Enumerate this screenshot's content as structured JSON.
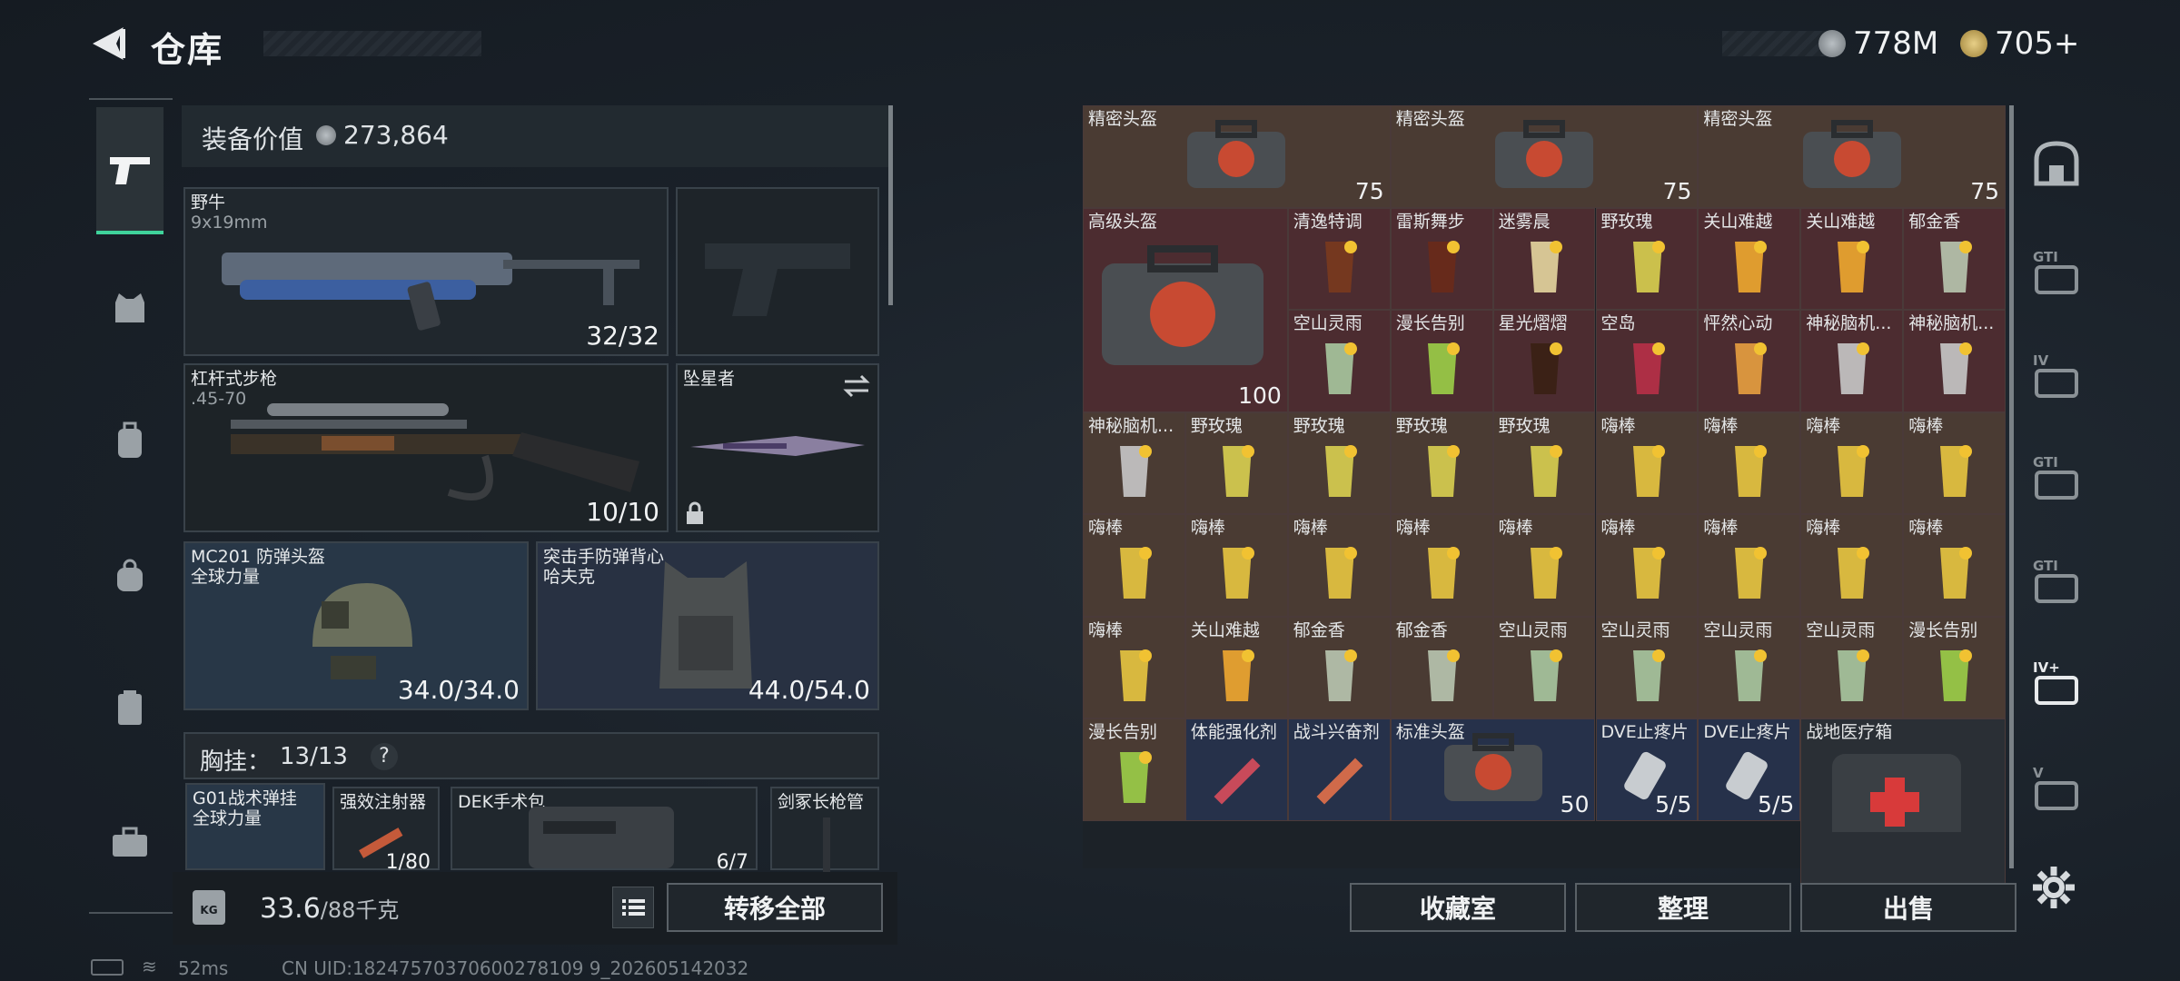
{
  "header": {
    "title": "仓库",
    "currency1": "778M",
    "currency2": "705+"
  },
  "left": {
    "value_label": "装备价值",
    "value": "273,864",
    "weapon1": {
      "name": "野牛",
      "ammo": "9x19mm",
      "count": "32/32"
    },
    "weapon2": {
      "name": "杠杆式步枪",
      "ammo": ".45-70",
      "count": "10/10"
    },
    "melee": {
      "name": "坠星者"
    },
    "helmet": {
      "name": "MC201 防弹头盔",
      "brand": "全球力量",
      "dur": "34.0/34.0"
    },
    "vest": {
      "name": "突击手防弹背心",
      "brand": "哈夫克",
      "dur": "44.0/54.0"
    },
    "chest_label": "胸挂：",
    "chest_count": "13/13",
    "chest_help": "?",
    "slot1": {
      "name": "G01战术弹挂",
      "brand": "全球力量"
    },
    "slot2": {
      "name": "强效注射器",
      "count": "1/80"
    },
    "slot3": {
      "name": "DEK手术包",
      "count": "6/7"
    },
    "slot4": {
      "name": "剑冢长枪管"
    },
    "weight": "33.6",
    "weight_max": "/88千克",
    "transfer_all": "转移全部",
    "kg": "KG"
  },
  "status": {
    "ping": "52ms",
    "uid": "CN UID:18247570370600278109 9_202605142032"
  },
  "grid": {
    "row0": [
      {
        "label": "精密头盔",
        "count": "75"
      },
      {
        "label": "精密头盔",
        "count": "75"
      },
      {
        "label": "精密头盔",
        "count": "75"
      }
    ],
    "big": {
      "label": "高级头盔",
      "count": "100"
    },
    "row1a": [
      "清逸特调",
      "雷斯舞步",
      "迷雾晨",
      "野玫瑰",
      "关山难越",
      "关山难越",
      "郁金香"
    ],
    "row1b": [
      "空山灵雨",
      "漫长告别",
      "星光熠熠",
      "空岛",
      "怦然心动",
      "神秘脑机...",
      "神秘脑机..."
    ],
    "row2": [
      "神秘脑机...",
      "野玫瑰",
      "野玫瑰",
      "野玫瑰",
      "野玫瑰",
      "嗨棒",
      "嗨棒",
      "嗨棒",
      "嗨棒"
    ],
    "row3": [
      "嗨棒",
      "嗨棒",
      "嗨棒",
      "嗨棒",
      "嗨棒",
      "嗨棒",
      "嗨棒",
      "嗨棒",
      "嗨棒"
    ],
    "row4": [
      "嗨棒",
      "关山难越",
      "郁金香",
      "郁金香",
      "空山灵雨",
      "空山灵雨",
      "空山灵雨",
      "空山灵雨",
      "漫长告别"
    ],
    "row5": {
      "a": "漫长告别",
      "b": "体能强化剂",
      "c": "战斗兴奋剂",
      "d": "标准头盔",
      "d_count": "50",
      "e": "DVE止疼片",
      "e_count": "5/5",
      "f": "DVE止疼片",
      "f_count": "5/5",
      "g": "战地医疗箱"
    }
  },
  "buttons": {
    "collection": "收藏室",
    "sort": "整理",
    "sell": "出售"
  },
  "right_nav": [
    "GTI",
    "IV",
    "GTI",
    "GTI",
    "IV+",
    "V"
  ],
  "colors": {
    "accent": "#3fd39b",
    "brown": "#4a3b33",
    "red": "#4c2c30",
    "blue": "#26314a"
  }
}
